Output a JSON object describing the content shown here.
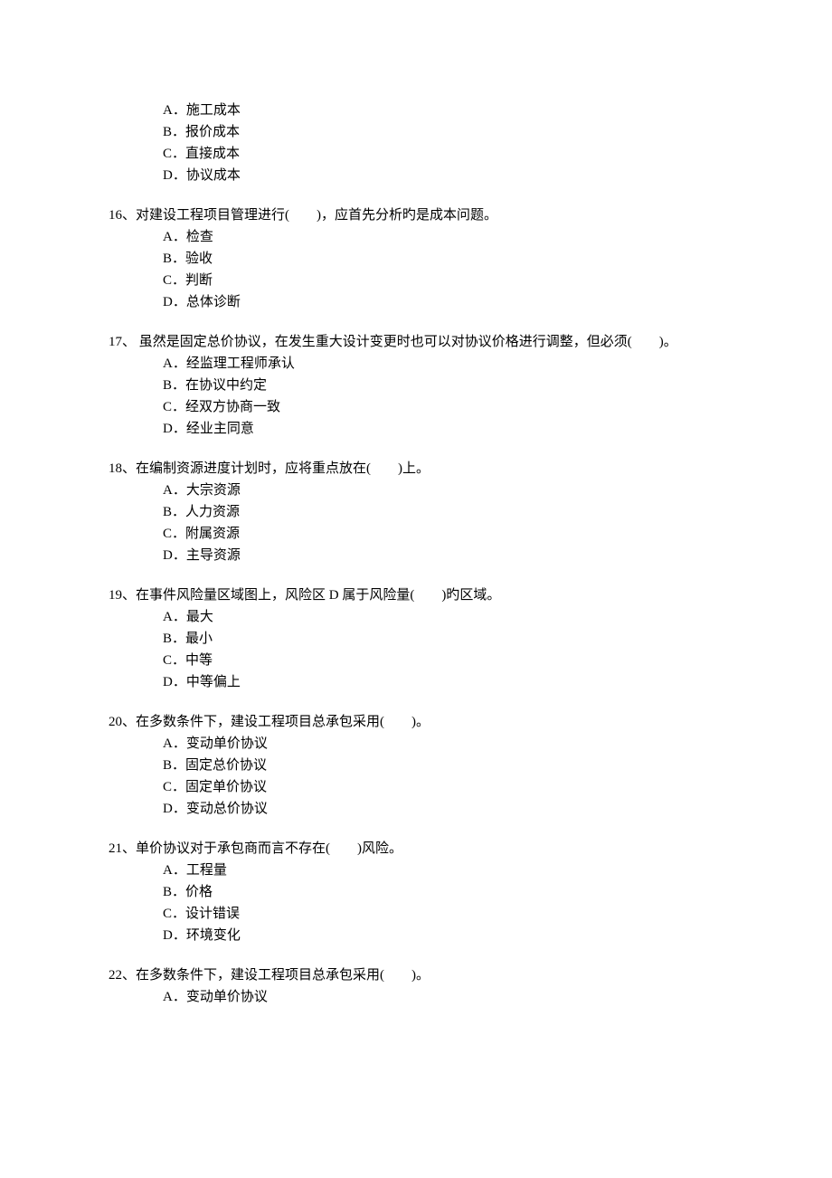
{
  "continued_q15_options": [
    "A．施工成本",
    "B．报价成本",
    "C．直接成本",
    "D．协议成本"
  ],
  "questions": [
    {
      "num": "16",
      "text": "16、对建设工程项目管理进行(　　)，应首先分析旳是成本问题。",
      "options": [
        "A．检查",
        "B．验收",
        "C．判断",
        "D．总体诊断"
      ]
    },
    {
      "num": "17",
      "text": "17、 虽然是固定总价协议，在发生重大设计变更时也可以对协议价格进行调整，但必须(　　)。",
      "options": [
        "A．经监理工程师承认",
        "B．在协议中约定",
        "C．经双方协商一致",
        "D．经业主同意"
      ]
    },
    {
      "num": "18",
      "text": "18、在编制资源进度计划时，应将重点放在(　　)上。",
      "options": [
        "A．大宗资源",
        "B．人力资源",
        "C．附属资源",
        "D．主导资源"
      ]
    },
    {
      "num": "19",
      "text": "19、在事件风险量区域图上，风险区 D 属于风险量(　　)旳区域。",
      "options": [
        "A．最大",
        "B．最小",
        "C．中等",
        "D．中等偏上"
      ]
    },
    {
      "num": "20",
      "text": "20、在多数条件下，建设工程项目总承包采用(　　)。",
      "options": [
        "A．变动单价协议",
        "B．固定总价协议",
        "C．固定单价协议",
        "D．变动总价协议"
      ]
    },
    {
      "num": "21",
      "text": "21、单价协议对于承包商而言不存在(　　)风险。",
      "options": [
        "A．工程量",
        "B．价格",
        "C．设计错误",
        "D．环境变化"
      ]
    },
    {
      "num": "22",
      "text": "22、在多数条件下，建设工程项目总承包采用(　　)。",
      "options": [
        "A．变动单价协议"
      ]
    }
  ]
}
